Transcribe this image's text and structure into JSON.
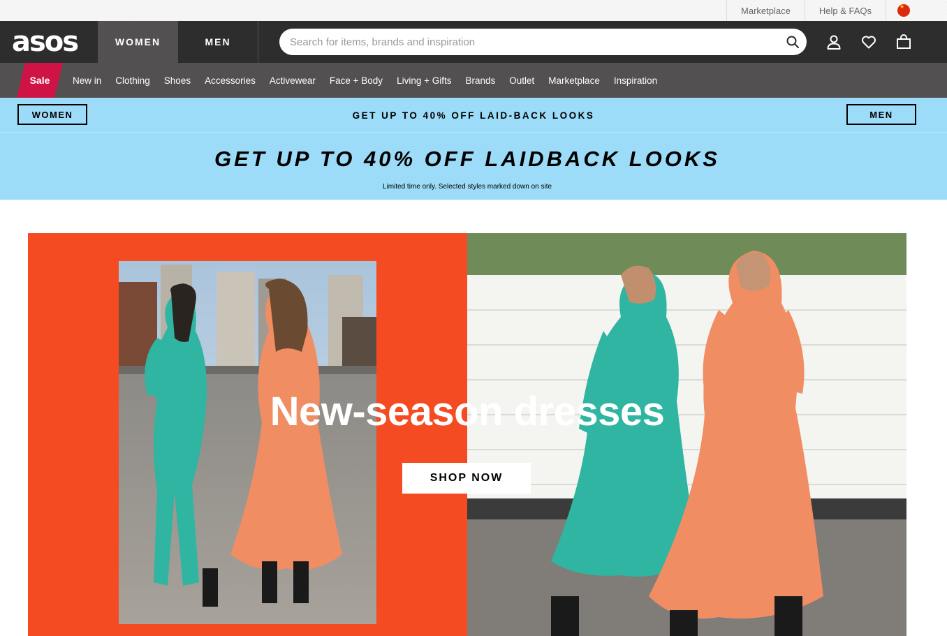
{
  "utility_bar": {
    "marketplace": "Marketplace",
    "help": "Help & FAQs",
    "country_flag_icon": "china-flag-icon"
  },
  "header": {
    "logo": "asos",
    "tab_women": "WOMEN",
    "tab_men": "MEN",
    "search_placeholder": "Search for items, brands and inspiration",
    "search_value": "",
    "icons": [
      "search-icon",
      "account-icon",
      "heart-icon",
      "bag-icon"
    ]
  },
  "nav": {
    "sale": "Sale",
    "items": [
      "New in",
      "Clothing",
      "Shoes",
      "Accessories",
      "Activewear",
      "Face + Body",
      "Living + Gifts",
      "Brands",
      "Outlet",
      "Marketplace",
      "Inspiration"
    ]
  },
  "promo_strip": {
    "women_button": "WOMEN",
    "text": "GET UP TO 40% OFF LAID-BACK LOOKS",
    "men_button": "MEN"
  },
  "banner": {
    "title": "GET UP TO 40% OFF LAIDBACK LOOKS",
    "subtitle": "Limited time only. Selected styles marked down on site"
  },
  "hero": {
    "title": "New-season dresses",
    "button": "SHOP NOW"
  },
  "colors": {
    "header_bg": "#2d2d2d",
    "nav_bg": "#525050",
    "sale_red": "#d01345",
    "promo_blue": "#9cdcf8",
    "hero_orange": "#f44b22"
  }
}
